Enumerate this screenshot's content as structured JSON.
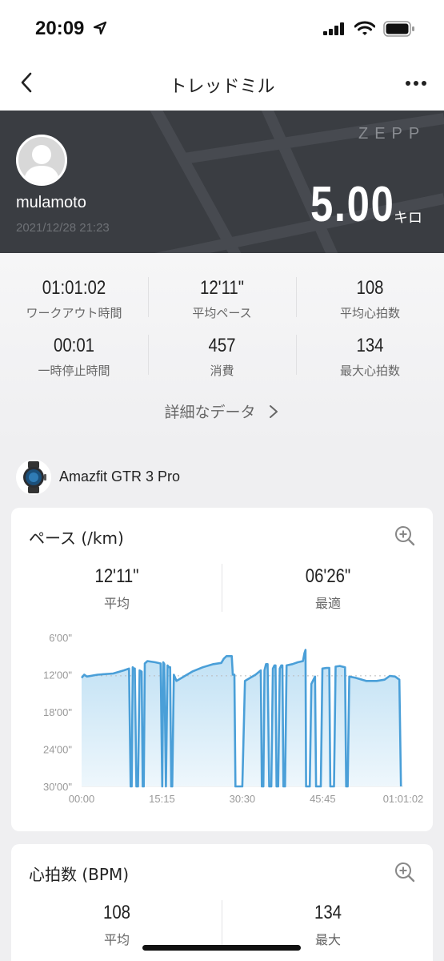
{
  "status_bar": {
    "time": "20:09"
  },
  "nav": {
    "title": "トレッドミル"
  },
  "hero": {
    "brand": "ZEPP",
    "username": "mulamoto",
    "datetime": "2021/12/28 21:23",
    "distance": "5.00",
    "distance_unit": "キロ"
  },
  "stats": [
    {
      "value": "01:01:02",
      "label": "ワークアウト時間"
    },
    {
      "value": "12'11\"",
      "label": "平均ペース"
    },
    {
      "value": "108",
      "label": "平均心拍数"
    },
    {
      "value": "00:01",
      "label": "一時停止時間"
    },
    {
      "value": "457",
      "label": "消費"
    },
    {
      "value": "134",
      "label": "最大心拍数"
    }
  ],
  "detail_link": "詳細なデータ",
  "device": {
    "name": "Amazfit GTR 3 Pro"
  },
  "pace_card": {
    "title": "ペース (/km)",
    "avg_value": "12'11\"",
    "avg_label": "平均",
    "best_value": "06'26\"",
    "best_label": "最適"
  },
  "hr_card": {
    "title": "心拍数 (BPM)",
    "avg_value": "108",
    "avg_label": "平均",
    "max_value": "134",
    "max_label": "最大"
  },
  "chart_data": {
    "type": "area",
    "ylabel": "",
    "xlabel": "",
    "y_ticks": [
      "6'00\"",
      "12'00\"",
      "18'00\"",
      "24'00\"",
      "30'00\""
    ],
    "y_tick_values": [
      6,
      12,
      18,
      24,
      30
    ],
    "ylim": [
      30,
      6
    ],
    "x_ticks": [
      "00:00",
      "15:15",
      "30:30",
      "45:45",
      "01:01:02"
    ],
    "x_tick_values": [
      0,
      15.25,
      30.5,
      45.75,
      61.03
    ],
    "xlim": [
      0,
      61.03
    ],
    "average_line": 12.18,
    "color": "#4a9fd8",
    "points": [
      [
        0.0,
        12.5
      ],
      [
        0.5,
        12.0
      ],
      [
        1.0,
        12.3
      ],
      [
        3.0,
        12.0
      ],
      [
        6.0,
        11.8
      ],
      [
        8.0,
        11.3
      ],
      [
        9.0,
        11.0
      ],
      [
        9.3,
        30.0
      ],
      [
        9.5,
        30.0
      ],
      [
        9.7,
        10.8
      ],
      [
        9.9,
        11.0
      ],
      [
        10.1,
        11.0
      ],
      [
        10.4,
        30.0
      ],
      [
        10.7,
        30.0
      ],
      [
        11.0,
        11.3
      ],
      [
        11.4,
        11.5
      ],
      [
        11.6,
        30.0
      ],
      [
        11.8,
        30.0
      ],
      [
        12.0,
        10.2
      ],
      [
        12.5,
        9.8
      ],
      [
        14.0,
        10.0
      ],
      [
        15.0,
        10.2
      ],
      [
        15.3,
        30.0
      ],
      [
        15.5,
        10.0
      ],
      [
        15.7,
        10.3
      ],
      [
        16.0,
        30.0
      ],
      [
        16.3,
        10.5
      ],
      [
        16.6,
        10.8
      ],
      [
        16.8,
        10.8
      ],
      [
        17.0,
        30.0
      ],
      [
        17.2,
        30.0
      ],
      [
        17.5,
        12.0
      ],
      [
        18.0,
        13.0
      ],
      [
        19.0,
        12.5
      ],
      [
        20.0,
        12.0
      ],
      [
        21.0,
        11.5
      ],
      [
        23.0,
        10.8
      ],
      [
        25.0,
        10.3
      ],
      [
        26.5,
        10.1
      ],
      [
        27.0,
        9.4
      ],
      [
        27.5,
        9.0
      ],
      [
        28.5,
        9.0
      ],
      [
        28.7,
        12.0
      ],
      [
        29.0,
        12.0
      ],
      [
        29.2,
        30.0
      ],
      [
        29.5,
        30.0
      ],
      [
        30.0,
        30.0
      ],
      [
        30.5,
        30.0
      ],
      [
        31.0,
        13.0
      ],
      [
        32.0,
        12.5
      ],
      [
        33.0,
        12.0
      ],
      [
        34.0,
        11.3
      ],
      [
        34.2,
        30.0
      ],
      [
        34.5,
        30.0
      ],
      [
        34.7,
        11.3
      ],
      [
        35.0,
        10.3
      ],
      [
        35.3,
        10.3
      ],
      [
        35.6,
        30.0
      ],
      [
        36.0,
        30.0
      ],
      [
        36.3,
        11.0
      ],
      [
        36.6,
        10.5
      ],
      [
        36.8,
        10.5
      ],
      [
        37.0,
        30.0
      ],
      [
        37.3,
        30.0
      ],
      [
        37.6,
        11.0
      ],
      [
        37.9,
        10.5
      ],
      [
        38.1,
        10.5
      ],
      [
        38.3,
        30.0
      ],
      [
        38.6,
        30.0
      ],
      [
        38.9,
        10.5
      ],
      [
        40.0,
        10.3
      ],
      [
        41.0,
        10.0
      ],
      [
        42.0,
        9.8
      ],
      [
        42.3,
        8.5
      ],
      [
        42.5,
        8.0
      ],
      [
        42.6,
        30.0
      ],
      [
        43.0,
        30.0
      ],
      [
        43.3,
        30.0
      ],
      [
        43.6,
        13.5
      ],
      [
        44.0,
        12.8
      ],
      [
        44.3,
        12.3
      ],
      [
        44.5,
        30.0
      ],
      [
        44.8,
        30.0
      ],
      [
        45.4,
        30.0
      ],
      [
        45.7,
        11.0
      ],
      [
        46.5,
        10.9
      ],
      [
        47.0,
        10.9
      ],
      [
        47.2,
        30.0
      ],
      [
        47.6,
        30.0
      ],
      [
        47.9,
        30.0
      ],
      [
        48.2,
        10.7
      ],
      [
        49.0,
        10.6
      ],
      [
        50.0,
        10.8
      ],
      [
        50.2,
        30.0
      ],
      [
        50.5,
        30.0
      ],
      [
        50.8,
        12.3
      ],
      [
        52.0,
        12.5
      ],
      [
        54.0,
        13.0
      ],
      [
        56.0,
        13.0
      ],
      [
        57.5,
        12.8
      ],
      [
        58.5,
        12.2
      ],
      [
        59.5,
        12.3
      ],
      [
        60.3,
        12.8
      ],
      [
        60.6,
        30.0
      ]
    ]
  }
}
